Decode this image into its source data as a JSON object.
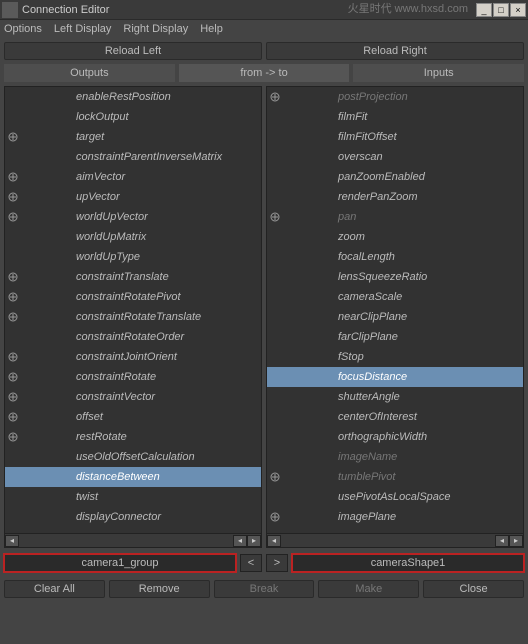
{
  "title": "Connection Editor",
  "watermark": "火星时代 www.hxsd.com",
  "win": {
    "min": "_",
    "max": "□",
    "close": "×"
  },
  "menu": {
    "options": "Options",
    "left": "Left Display",
    "right": "Right Display",
    "help": "Help"
  },
  "reload": {
    "left": "Reload Left",
    "right": "Reload Right"
  },
  "colhdr": {
    "outputs": "Outputs",
    "fromto": "from -> to",
    "inputs": "Inputs"
  },
  "left": {
    "items": [
      {
        "label": "enableRestPosition",
        "exp": false,
        "dim": false
      },
      {
        "label": "lockOutput",
        "exp": false,
        "dim": false
      },
      {
        "label": "target",
        "exp": true,
        "dim": false
      },
      {
        "label": "constraintParentInverseMatrix",
        "exp": false,
        "dim": false
      },
      {
        "label": "aimVector",
        "exp": true,
        "dim": false
      },
      {
        "label": "upVector",
        "exp": true,
        "dim": false
      },
      {
        "label": "worldUpVector",
        "exp": true,
        "dim": false
      },
      {
        "label": "worldUpMatrix",
        "exp": false,
        "dim": false
      },
      {
        "label": "worldUpType",
        "exp": false,
        "dim": false
      },
      {
        "label": "constraintTranslate",
        "exp": true,
        "dim": false
      },
      {
        "label": "constraintRotatePivot",
        "exp": true,
        "dim": false
      },
      {
        "label": "constraintRotateTranslate",
        "exp": true,
        "dim": false
      },
      {
        "label": "constraintRotateOrder",
        "exp": false,
        "dim": false
      },
      {
        "label": "constraintJointOrient",
        "exp": true,
        "dim": false
      },
      {
        "label": "constraintRotate",
        "exp": true,
        "dim": false
      },
      {
        "label": "constraintVector",
        "exp": true,
        "dim": false
      },
      {
        "label": "offset",
        "exp": true,
        "dim": false
      },
      {
        "label": "restRotate",
        "exp": true,
        "dim": false
      },
      {
        "label": "useOldOffsetCalculation",
        "exp": false,
        "dim": false
      },
      {
        "label": "distanceBetween",
        "exp": false,
        "dim": false,
        "sel": true,
        "hl": true
      },
      {
        "label": "twist",
        "exp": false,
        "dim": false
      },
      {
        "label": "displayConnector",
        "exp": false,
        "dim": false
      }
    ],
    "field": "camera1_group"
  },
  "right": {
    "items": [
      {
        "label": "postProjection",
        "exp": true,
        "dim": true
      },
      {
        "label": "filmFit",
        "exp": false,
        "dim": false
      },
      {
        "label": "filmFitOffset",
        "exp": false,
        "dim": false
      },
      {
        "label": "overscan",
        "exp": false,
        "dim": false
      },
      {
        "label": "panZoomEnabled",
        "exp": false,
        "dim": false
      },
      {
        "label": "renderPanZoom",
        "exp": false,
        "dim": false
      },
      {
        "label": "pan",
        "exp": true,
        "dim": true
      },
      {
        "label": "zoom",
        "exp": false,
        "dim": false
      },
      {
        "label": "focalLength",
        "exp": false,
        "dim": false
      },
      {
        "label": "lensSqueezeRatio",
        "exp": false,
        "dim": false
      },
      {
        "label": "cameraScale",
        "exp": false,
        "dim": false
      },
      {
        "label": "nearClipPlane",
        "exp": false,
        "dim": false
      },
      {
        "label": "farClipPlane",
        "exp": false,
        "dim": false
      },
      {
        "label": "fStop",
        "exp": false,
        "dim": false
      },
      {
        "label": "focusDistance",
        "exp": false,
        "dim": false,
        "sel": true,
        "hl": true
      },
      {
        "label": "shutterAngle",
        "exp": false,
        "dim": false
      },
      {
        "label": "centerOfInterest",
        "exp": false,
        "dim": false
      },
      {
        "label": "orthographicWidth",
        "exp": false,
        "dim": false
      },
      {
        "label": "imageName",
        "exp": false,
        "dim": true
      },
      {
        "label": "tumblePivot",
        "exp": true,
        "dim": true
      },
      {
        "label": "usePivotAsLocalSpace",
        "exp": false,
        "dim": false
      },
      {
        "label": "imagePlane",
        "exp": true,
        "dim": false
      }
    ],
    "field": "cameraShape1"
  },
  "mid": {
    "lt": "<",
    "gt": ">"
  },
  "bottom": {
    "clearall": "Clear All",
    "remove": "Remove",
    "break": "Break",
    "make": "Make",
    "close": "Close"
  }
}
